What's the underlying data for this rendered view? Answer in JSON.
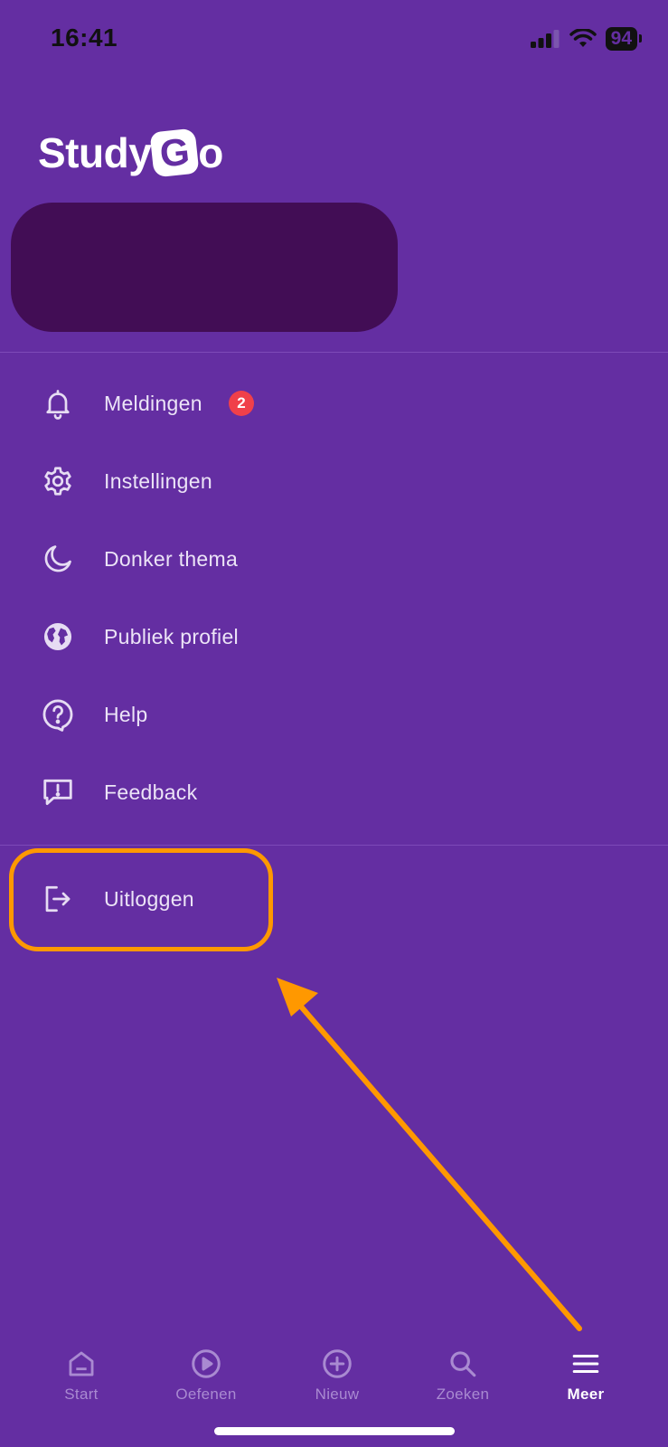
{
  "status_bar": {
    "time": "16:41",
    "battery": "94"
  },
  "brand": {
    "name_prefix": "Study",
    "name_g": "G",
    "name_suffix": "o"
  },
  "menu": {
    "items": [
      {
        "label": "Meldingen",
        "icon": "bell-icon",
        "badge": "2"
      },
      {
        "label": "Instellingen",
        "icon": "gear-icon"
      },
      {
        "label": "Donker thema",
        "icon": "moon-icon"
      },
      {
        "label": "Publiek profiel",
        "icon": "globe-icon"
      },
      {
        "label": "Help",
        "icon": "help-icon"
      },
      {
        "label": "Feedback",
        "icon": "feedback-icon"
      }
    ],
    "logout": {
      "label": "Uitloggen",
      "icon": "logout-icon"
    }
  },
  "tabs": [
    {
      "label": "Start",
      "icon": "home-icon",
      "active": false
    },
    {
      "label": "Oefenen",
      "icon": "play-icon",
      "active": false
    },
    {
      "label": "Nieuw",
      "icon": "plus-circle-icon",
      "active": false
    },
    {
      "label": "Zoeken",
      "icon": "search-icon",
      "active": false
    },
    {
      "label": "Meer",
      "icon": "menu-icon",
      "active": true
    }
  ],
  "colors": {
    "background": "#642ea2",
    "profile_card": "#420d55",
    "badge": "#f0404a",
    "highlight": "#ff9800"
  }
}
